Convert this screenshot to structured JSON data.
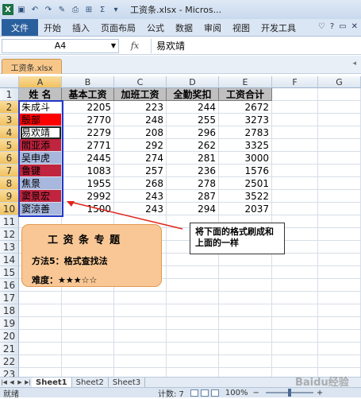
{
  "window": {
    "title": "工资条.xlsx - Micros...",
    "quick_access": [
      "save-icon",
      "undo-icon",
      "redo-icon",
      "format-painter-icon",
      "preview-icon",
      "border-icon",
      "sum-icon",
      "filter-icon"
    ]
  },
  "ribbon": {
    "file_label": "文件",
    "tabs": [
      "开始",
      "插入",
      "页面布局",
      "公式",
      "数据",
      "审阅",
      "视图",
      "开发工具"
    ],
    "right_icons": [
      "♡",
      "?",
      "▭",
      "✕"
    ]
  },
  "formula_bar": {
    "cell_ref": "A4",
    "fx": "fx",
    "value": "易欢靖"
  },
  "doc_tab": "工资条.xlsx",
  "sheet": {
    "columns": [
      "A",
      "B",
      "C",
      "D",
      "E",
      "F",
      "G"
    ],
    "rows": [
      "1",
      "2",
      "3",
      "4",
      "5",
      "6",
      "7",
      "8",
      "9",
      "10",
      "11",
      "12",
      "13",
      "14",
      "15",
      "16",
      "17",
      "18",
      "19",
      "20",
      "21",
      "22",
      "23"
    ],
    "header": [
      "姓  名",
      "基本工资",
      "加班工资",
      "全勤奖扣",
      "工资合计"
    ],
    "data": [
      {
        "name": "朱成斗",
        "base": "2205",
        "overtime": "223",
        "attend": "244",
        "total": "2672",
        "fill": "#ffffff"
      },
      {
        "name": "殷部",
        "base": "2770",
        "overtime": "248",
        "attend": "255",
        "total": "3273",
        "fill": "#ff0000"
      },
      {
        "name": "易欢靖",
        "base": "2279",
        "overtime": "208",
        "attend": "296",
        "total": "2783",
        "fill": "#ffffff"
      },
      {
        "name": "閻亚添",
        "base": "2771",
        "overtime": "292",
        "attend": "262",
        "total": "3325",
        "fill": "#c0243e"
      },
      {
        "name": "吴申虎",
        "base": "2445",
        "overtime": "274",
        "attend": "281",
        "total": "3000",
        "fill": "#a7b7de"
      },
      {
        "name": "鲁键",
        "base": "1083",
        "overtime": "257",
        "attend": "236",
        "total": "1576",
        "fill": "#c0243e"
      },
      {
        "name": "焦景",
        "base": "1955",
        "overtime": "268",
        "attend": "278",
        "total": "2501",
        "fill": "#a7b7de"
      },
      {
        "name": "窦景宏",
        "base": "2992",
        "overtime": "243",
        "attend": "287",
        "total": "3522",
        "fill": "#c0243e"
      },
      {
        "name": "窦涼善",
        "base": "1500",
        "overtime": "243",
        "attend": "294",
        "total": "2037",
        "fill": "#a7b7de"
      }
    ]
  },
  "callout_left": {
    "title": "工 资 条 专 题",
    "line1": "方法5：格式查找法",
    "line2": "难度：★★★☆☆"
  },
  "callout_right": {
    "text": "将下面的格式刷成和上面的一样"
  },
  "sheet_tabs": [
    "Sheet1",
    "Sheet2",
    "Sheet3"
  ],
  "status": {
    "ready": "就绪",
    "count": "计数: 7",
    "zoom": "100%",
    "zoom_plus": "+",
    "zoom_minus": "−"
  },
  "watermark": "Baidu经验"
}
